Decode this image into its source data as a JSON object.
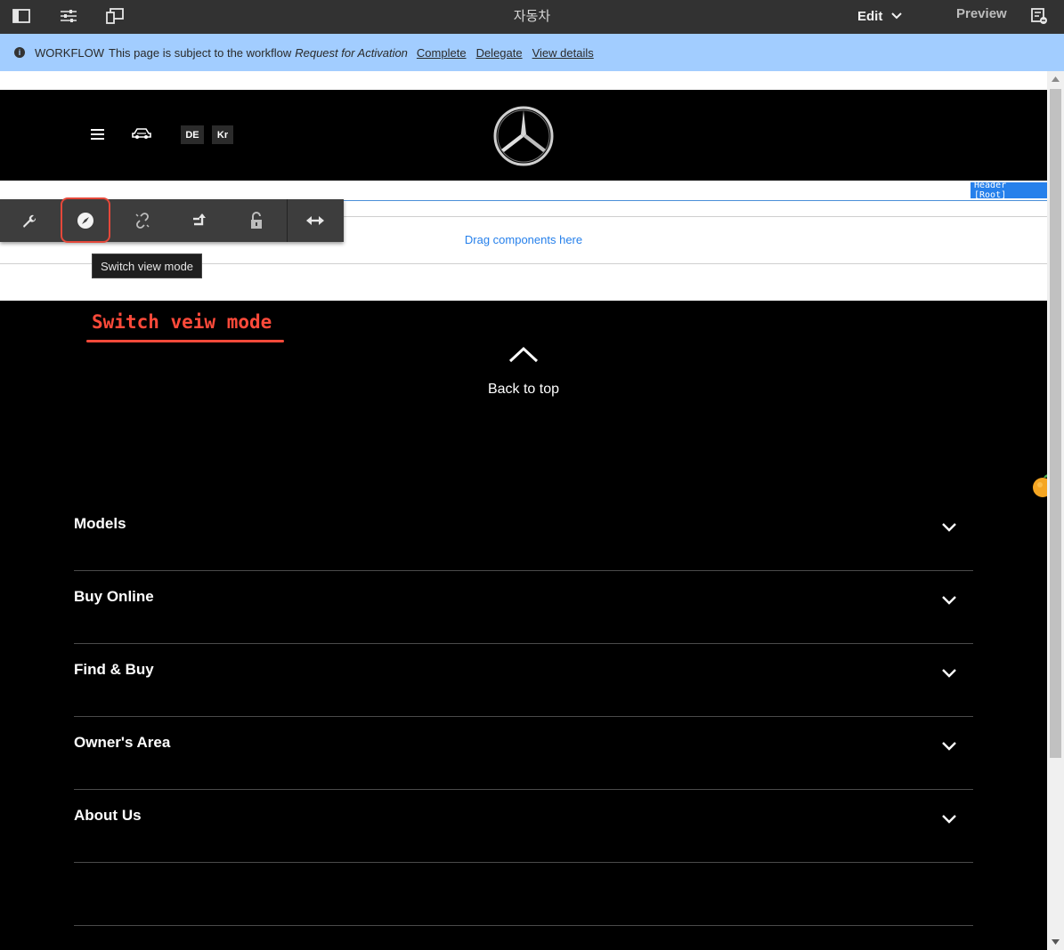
{
  "topbar": {
    "title": "자동차",
    "edit_label": "Edit",
    "preview_label": "Preview",
    "icons": [
      "side-panel-icon",
      "page-properties-icon",
      "emulator-icon",
      "annotations-icon"
    ]
  },
  "workflow": {
    "label": "WORKFLOW",
    "message": "This page is subject to the workflow",
    "workflow_name": "Request for Activation",
    "links": [
      "Complete",
      "Delegate",
      "View details"
    ]
  },
  "header": {
    "lang_de": "DE",
    "lang_kr": "Kr",
    "component_tag": "Header [Root]"
  },
  "editor": {
    "drag_placeholder": "Drag components here",
    "toolbar_tools": [
      "configure-icon",
      "switch-view-mode-icon",
      "unlink-icon",
      "parent-icon",
      "unlock-icon",
      "layout-icon"
    ],
    "tooltip": "Switch view mode",
    "annotation": "Switch veiw mode"
  },
  "footer": {
    "back_to_top": "Back to top",
    "sections": [
      "Models",
      "Buy Online",
      "Find & Buy",
      "Owner's Area",
      "About Us"
    ]
  },
  "colors": {
    "topbar_bg": "#323232",
    "workflow_bg": "#a2cdff",
    "accent_blue": "#2680eb",
    "annotation_red": "#ff4a3a"
  }
}
